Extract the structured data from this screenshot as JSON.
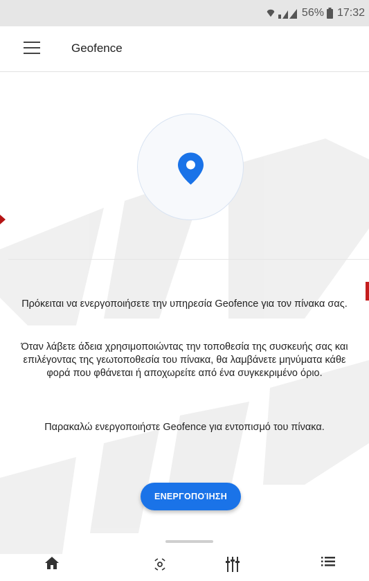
{
  "status_bar": {
    "battery": "56%",
    "time": "17:32"
  },
  "app_bar": {
    "title": "Geofence"
  },
  "content": {
    "intro": "Πρόκειται να ενεργοποιήσετε την υπηρεσία Geofence για τον πίνακα σας.",
    "description": "Όταν λάβετε άδεια χρησιμοποιώντας την τοποθεσία της συσκευής σας και επιλέγοντας της γεωτοποθεσία του πίνακα, θα λαμβάνετε μηνύματα κάθε φορά που φθάνεται ή αποχωρείτε από ένα συγκεκριμένο όριο.",
    "prompt": "Παρακαλώ ενεργοποιήστε Geofence για εντοπισμό του πίνακα.",
    "activate_label": "ΕΝΕΡΓΟΠΟΊΗΣΗ"
  },
  "bottom_nav": {
    "items": [
      {
        "icon": "home-icon"
      },
      {
        "icon": "sensor-icon"
      },
      {
        "icon": "equalizer-icon"
      },
      {
        "icon": "list-icon"
      }
    ]
  },
  "colors": {
    "accent": "#1a73e8",
    "watermark": "#d9d9d9",
    "status_bar": "#e6e6e6"
  }
}
